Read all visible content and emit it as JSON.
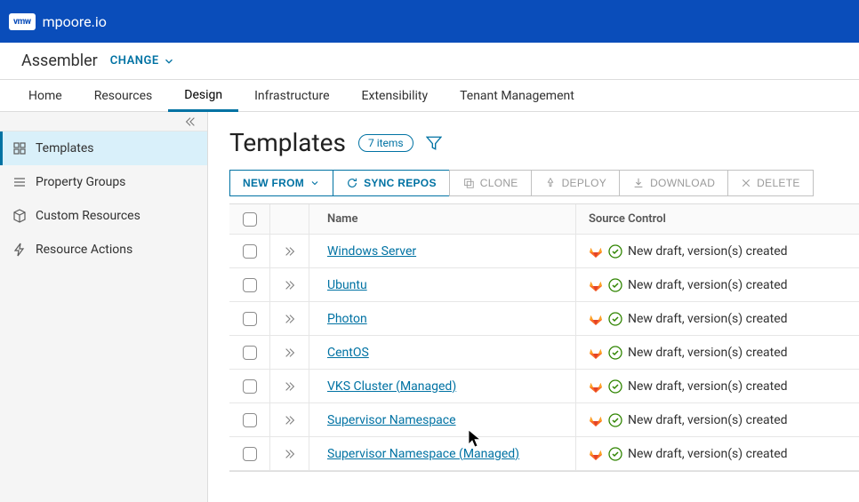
{
  "header": {
    "logo": "vmw",
    "brand": "mpoore.io"
  },
  "subheader": {
    "title": "Assembler",
    "change": "CHANGE"
  },
  "tabs": [
    "Home",
    "Resources",
    "Design",
    "Infrastructure",
    "Extensibility",
    "Tenant Management"
  ],
  "active_tab": 2,
  "sidebar": {
    "items": [
      {
        "label": "Templates",
        "icon": "templates"
      },
      {
        "label": "Property Groups",
        "icon": "list"
      },
      {
        "label": "Custom Resources",
        "icon": "cube"
      },
      {
        "label": "Resource Actions",
        "icon": "bolt"
      }
    ],
    "active": 0
  },
  "page": {
    "title": "Templates",
    "count_label": "7 items"
  },
  "toolbar": {
    "new_from": "NEW FROM",
    "sync": "SYNC REPOS",
    "clone": "CLONE",
    "deploy": "DEPLOY",
    "download": "DOWNLOAD",
    "delete": "DELETE"
  },
  "columns": {
    "name": "Name",
    "source": "Source Control"
  },
  "rows": [
    {
      "name": "Windows Server",
      "status": "New draft, version(s) created"
    },
    {
      "name": "Ubuntu",
      "status": "New draft, version(s) created"
    },
    {
      "name": "Photon",
      "status": "New draft, version(s) created"
    },
    {
      "name": "CentOS",
      "status": "New draft, version(s) created"
    },
    {
      "name": "VKS Cluster (Managed)",
      "status": "New draft, version(s) created"
    },
    {
      "name": "Supervisor Namespace",
      "status": "New draft, version(s) created"
    },
    {
      "name": "Supervisor Namespace (Managed)",
      "status": "New draft, version(s) created"
    }
  ]
}
